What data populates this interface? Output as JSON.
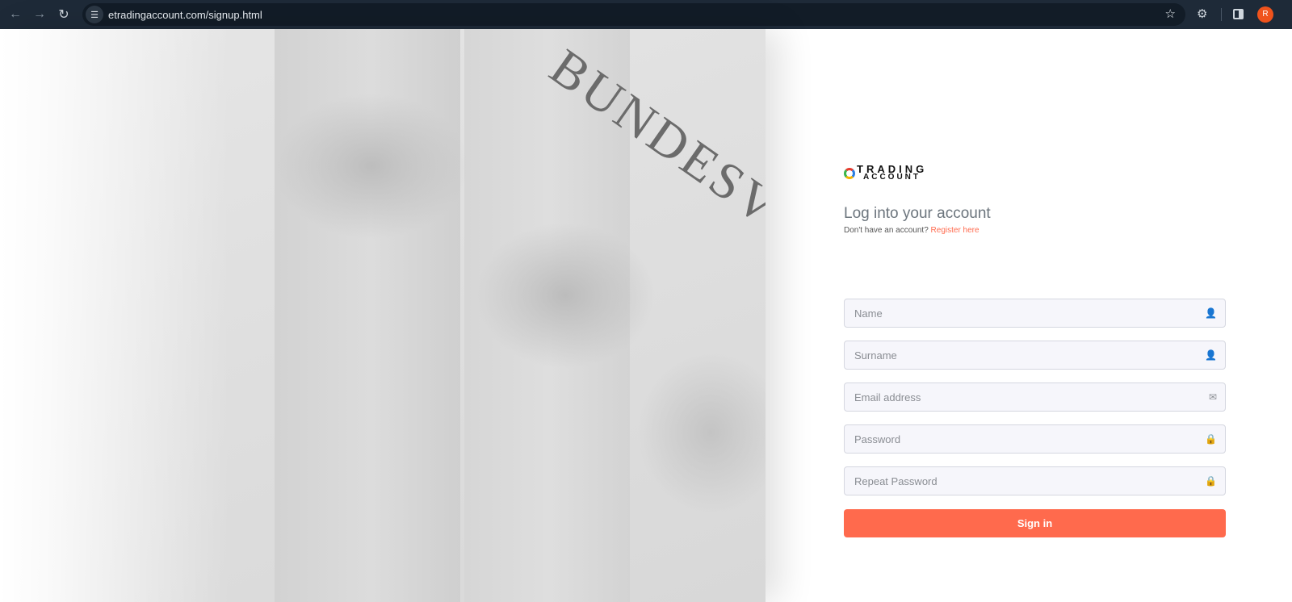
{
  "browser": {
    "url": "etradingaccount.com/signup.html",
    "avatar_initial": "R"
  },
  "hero": {
    "engraving": "BUNDESVE"
  },
  "logo": {
    "line1": "TRADING",
    "line2": "ACCOUNT"
  },
  "form": {
    "title": "Log into your account",
    "subtitle": "Don't have an account?",
    "register_link": "Register here",
    "fields": [
      {
        "placeholder": "Name",
        "icon": "user-icon"
      },
      {
        "placeholder": "Surname",
        "icon": "user-icon"
      },
      {
        "placeholder": "Email address",
        "icon": "envelope-icon"
      },
      {
        "placeholder": "Password",
        "icon": "lock-icon"
      },
      {
        "placeholder": "Repeat Password",
        "icon": "lock-icon"
      }
    ],
    "submit_label": "Sign in"
  },
  "colors": {
    "accent": "#ff6a4d",
    "topbar": "#1e2a38"
  }
}
